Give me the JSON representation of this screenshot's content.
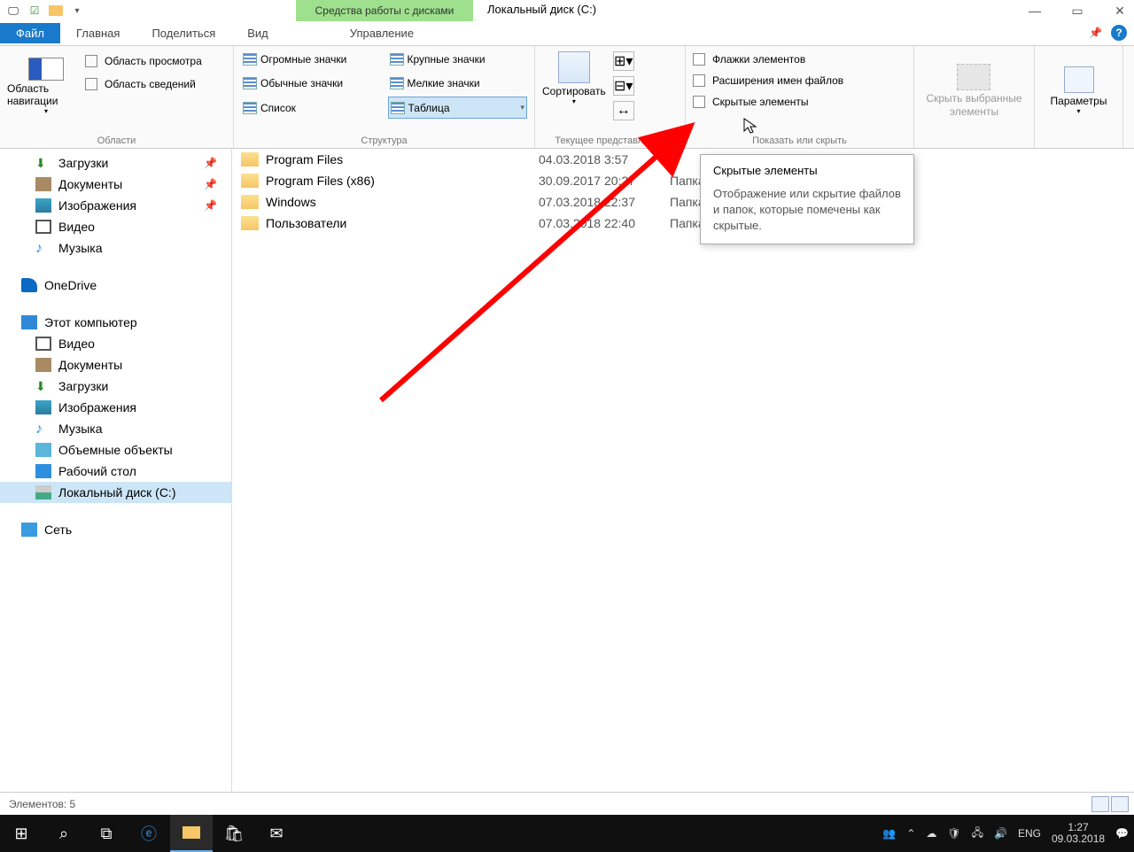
{
  "title": {
    "context_tab": "Средства работы с дисками",
    "window_title": "Локальный диск (C:)"
  },
  "tabs": {
    "file": "Файл",
    "home": "Главная",
    "share": "Поделиться",
    "view": "Вид",
    "manage": "Управление"
  },
  "ribbon": {
    "areas": {
      "label": "Области",
      "nav_pane": "Область навигации",
      "preview": "Область просмотра",
      "details": "Область сведений"
    },
    "layout": {
      "label": "Структура",
      "huge": "Огромные значки",
      "large": "Крупные значки",
      "medium": "Обычные значки",
      "small": "Мелкие значки",
      "list": "Список",
      "table": "Таблица"
    },
    "sort": {
      "label": "Текущее представление",
      "sort_btn": "Сортировать"
    },
    "show": {
      "label": "Показать или скрыть",
      "checkboxes": "Флажки элементов",
      "extensions": "Расширения имен файлов",
      "hidden": "Скрытые элементы"
    },
    "hide": {
      "btn_l1": "Скрыть выбранные",
      "btn_l2": "элементы"
    },
    "options": "Параметры"
  },
  "sidebar": {
    "downloads": "Загрузки",
    "documents": "Документы",
    "pictures": "Изображения",
    "videos": "Видео",
    "music": "Музыка",
    "onedrive": "OneDrive",
    "thispc": "Этот компьютер",
    "pc_videos": "Видео",
    "pc_docs": "Документы",
    "pc_downloads": "Загрузки",
    "pc_pictures": "Изображения",
    "pc_music": "Музыка",
    "pc_3d": "Объемные объекты",
    "pc_desktop": "Рабочий стол",
    "pc_disk": "Локальный диск (C:)",
    "network": "Сеть"
  },
  "files": [
    {
      "name": "Program Files",
      "date": "04.03.2018 3:57",
      "type": ""
    },
    {
      "name": "Program Files (x86)",
      "date": "30.09.2017 20:27",
      "type": "Папка"
    },
    {
      "name": "Windows",
      "date": "07.03.2018 22:37",
      "type": "Папка"
    },
    {
      "name": "Пользователи",
      "date": "07.03.2018 22:40",
      "type": "Папка"
    }
  ],
  "tooltip": {
    "title": "Скрытые элементы",
    "body": "Отображение или скрытие файлов и папок, которые помечены как скрытые."
  },
  "status": "Элементов: 5",
  "taskbar": {
    "lang": "ENG",
    "time": "1:27",
    "date": "09.03.2018"
  }
}
